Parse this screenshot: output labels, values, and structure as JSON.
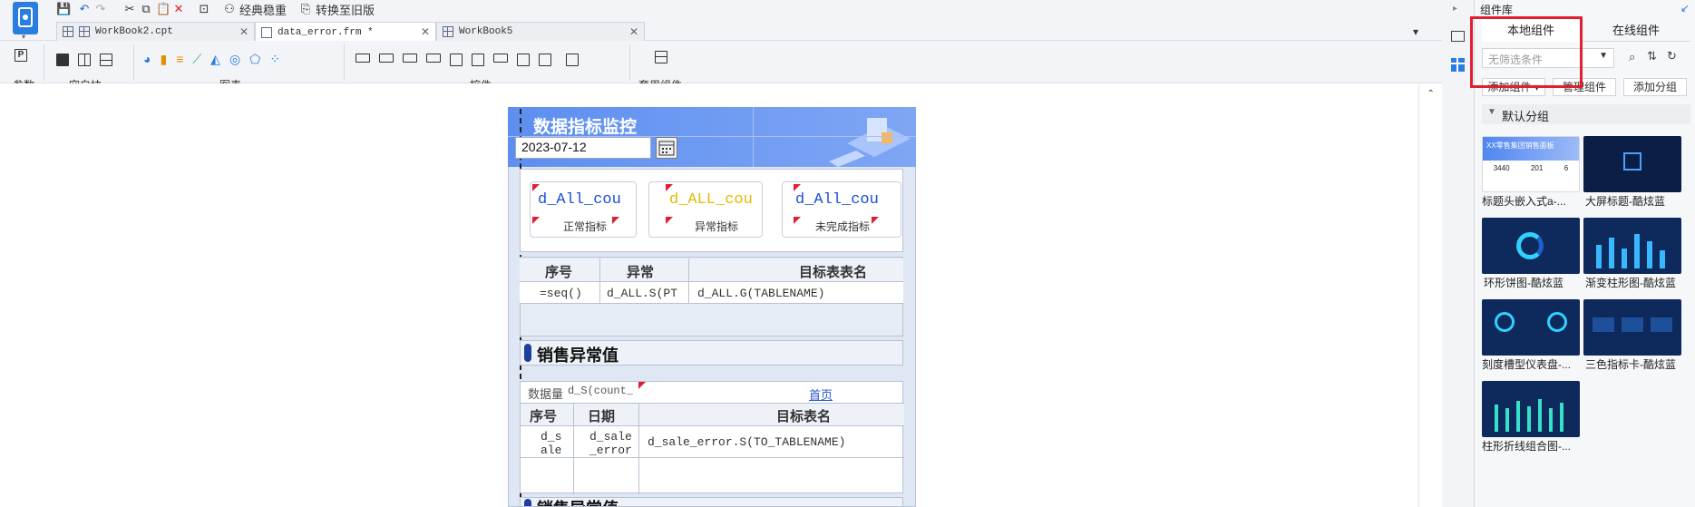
{
  "quick_access": {
    "classic_label": "经典稳重",
    "convert_label": "转换至旧版"
  },
  "tabs": [
    {
      "label": "WorkBook2.cpt"
    },
    {
      "label": "data_error.frm *"
    },
    {
      "label": "WorkBook5"
    }
  ],
  "toolbar_groups": {
    "param": "参数",
    "blank": "空白块",
    "chart": "图表",
    "widget": "控件",
    "template": "套用组件"
  },
  "form": {
    "title": "数据指标监控",
    "date_value": "2023-07-12",
    "kpis": [
      {
        "value": "d_All_cou",
        "label": "正常指标",
        "color": "#1c4fd6"
      },
      {
        "value": "d_ALL_cou",
        "label": "异常指标",
        "color": "#e6b800"
      },
      {
        "value": "d_All_cou",
        "label": "未完成指标",
        "color": "#1c4fd6"
      }
    ],
    "table1": {
      "headers": [
        "序号",
        "异常",
        "目标表表名"
      ],
      "row": [
        "=seq()",
        "d_ALL.S(PT",
        "d_ALL.G(TABLENAME)"
      ]
    },
    "section_title": "销售异常值",
    "table2": {
      "meta_label": "数据量",
      "meta_value": "d_S(count_",
      "link": "首页",
      "headers": [
        "序号",
        "日期",
        "目标表名"
      ],
      "row": [
        "d_sale",
        "d_sale_error",
        "d_sale_error.S(TO_TABLENAME)"
      ]
    },
    "section2_title": "销售异常值"
  },
  "library": {
    "title": "组件库",
    "tab_local": "本地组件",
    "tab_online": "在线组件",
    "filter_placeholder": "无筛选条件",
    "add_component": "添加组件",
    "manage_component": "管理组件",
    "add_group": "添加分组",
    "group_name": "默认分组",
    "items": [
      {
        "caption": "标题头嵌入式a-..."
      },
      {
        "caption": "大屏标题-酷炫蓝"
      },
      {
        "caption": "环形饼图-酷炫蓝"
      },
      {
        "caption": "渐变柱形图-酷炫蓝"
      },
      {
        "caption": "刻度槽型仪表盘-..."
      },
      {
        "caption": "三色指标卡-酷炫蓝"
      },
      {
        "caption": "柱形折线组合图-..."
      }
    ],
    "thumb1_title": "XX零售集团销售面板",
    "thumb1_nums": [
      "3440",
      "201",
      "6"
    ]
  },
  "colors": {
    "accent": "#2a7de1",
    "highlight": "#e02030",
    "thumb_dark": "#0e2a5c"
  }
}
